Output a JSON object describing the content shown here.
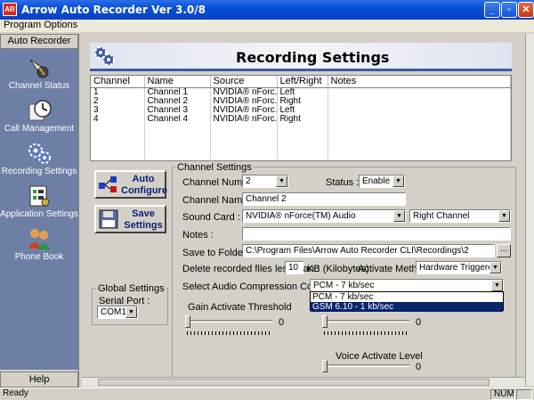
{
  "window": {
    "title": "Arrow Auto Recorder Ver 3.0/8",
    "icon_text": "AR"
  },
  "menu": {
    "items": [
      "Program Options"
    ]
  },
  "sidebar": {
    "header": "Auto Recorder",
    "items": [
      {
        "label": "Channel Status",
        "icon": "phonograph-icon"
      },
      {
        "label": "Call Management",
        "icon": "clock-icon"
      },
      {
        "label": "Recording Settings",
        "icon": "gears-icon"
      },
      {
        "label": "Application Settings",
        "icon": "settings-sheet-icon"
      },
      {
        "label": "Phone Book",
        "icon": "people-icon"
      }
    ],
    "help": "Help"
  },
  "main": {
    "title": "Recording Settings",
    "table": {
      "columns": [
        "Channel",
        "Name",
        "Source",
        "Left/Right",
        "Notes"
      ],
      "rows": [
        [
          "1",
          "Channel 1",
          "NVIDIA® nForc...",
          "Left",
          ""
        ],
        [
          "2",
          "Channel 2",
          "NVIDIA® nForc...",
          "Right",
          ""
        ],
        [
          "3",
          "Channel 3",
          "NVIDIA® nForc...",
          "Left",
          ""
        ],
        [
          "4",
          "Channel 4",
          "NVIDIA® nForc...",
          "Right",
          ""
        ]
      ]
    },
    "buttons": {
      "auto_configure": "Auto Configure",
      "save_settings": "Save Settings"
    },
    "global": {
      "title": "Global Settings",
      "serial_port_label": "Serial Port :",
      "serial_port_value": "COM1"
    },
    "channel": {
      "title": "Channel Settings",
      "channel_number_label": "Channel Number :",
      "channel_number_value": "2",
      "status_label": "Status :",
      "status_value": "Enable",
      "channel_name_label": "Channel Name :",
      "channel_name_value": "Channel 2",
      "sound_card_label": "Sound Card :",
      "sound_card_value": "NVIDIA® nForce(TM) Audio",
      "channel_side_value": "Right Channel",
      "notes_label": "Notes :",
      "notes_value": "",
      "save_folder_label": "Save to Folder :",
      "save_folder_value": "C:\\Program Files\\Arrow Auto Recorder CLI\\Recordings\\2",
      "browse_label": "...",
      "delete_label": "Delete recorded files less than :",
      "delete_value": "10",
      "delete_unit": "KB (Kilobytes)",
      "activate_label": "Activate Method :",
      "activate_value": "Hardware Triggered",
      "codec_label": "Select Audio Compression Codec :",
      "codec_value": "PCM - 7 kb/sec",
      "codec_options": [
        "PCM - 7 kb/sec",
        "GSM 6.10 - 1 kb/sec"
      ],
      "gain_label": "Gain Activate Threshold",
      "gain_value": "0",
      "second_slider_value": "0",
      "voice_label": "Voice Activate Level",
      "voice_value": "0"
    }
  },
  "status": {
    "left": "Ready",
    "num": "NUM"
  }
}
